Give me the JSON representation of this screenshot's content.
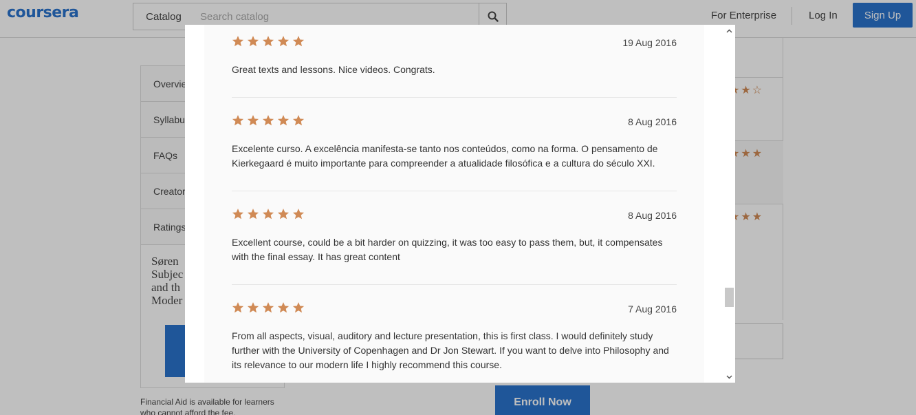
{
  "header": {
    "logo": "coursera",
    "catalog_label": "Catalog",
    "search_placeholder": "Search catalog",
    "enterprise_label": "For Enterprise",
    "login_label": "Log In",
    "signup_label": "Sign Up",
    "brand_color": "#2a73cc"
  },
  "sidebar": {
    "items": [
      {
        "label": "Overvie"
      },
      {
        "label": "Syllabu"
      },
      {
        "label": "FAQs"
      },
      {
        "label": "Creator"
      },
      {
        "label": "Ratings"
      }
    ],
    "card_text": "Søren Subjec and th Moder"
  },
  "financial_aid": "Financial Aid is available for learners who cannot afford the fee.",
  "enroll_label": "Enroll Now",
  "modal": {
    "star_color": "#d08a55",
    "reviews": [
      {
        "rating": 5,
        "date": "19 Aug 2016",
        "text": "Great texts and lessons. Nice videos. Congrats."
      },
      {
        "rating": 5,
        "date": "8 Aug 2016",
        "text": "Excelente curso. A excelência manifesta-se tanto nos conteúdos, como na forma. O pensamento de Kierkegaard é muito importante para compreender a atualidade filosófica e a cultura do século XXI."
      },
      {
        "rating": 5,
        "date": "8 Aug 2016",
        "text": "Excellent course, could be a bit harder on quizzing, it was too easy to pass them, but, it compensates with the final essay. It has great content"
      },
      {
        "rating": 5,
        "date": "7 Aug 2016",
        "text": "From all aspects, visual, auditory and lecture presentation, this is first class. I would definitely study further with the University of Copenhagen and Dr Jon Stewart. If you want to delve into Philosophy and its relevance to our modern life I highly recommend this course."
      }
    ]
  },
  "icons": {
    "search": "search-icon",
    "star": "star-icon",
    "scroll_up": "chevron-up-icon",
    "scroll_down": "chevron-down-icon"
  }
}
